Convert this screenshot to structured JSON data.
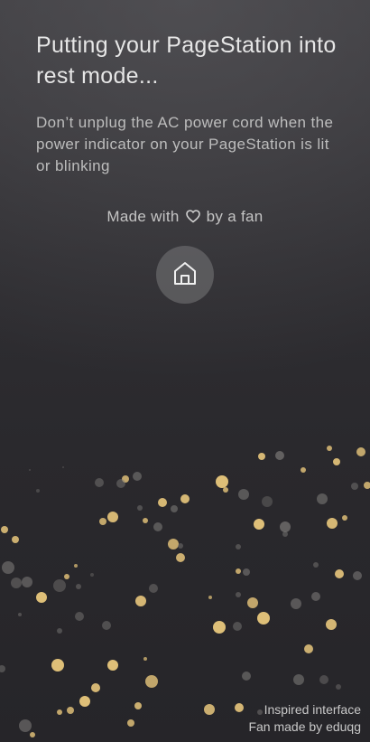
{
  "screen": {
    "title": "Putting your PageStation into rest mode...",
    "message": "Don’t unplug the AC power cord when the power indicator on your PageStation is lit or blinking",
    "made_with": {
      "prefix": "Made with",
      "heart_icon": "heart-outline-icon",
      "suffix": "by a fan"
    },
    "home_button": {
      "icon": "home-icon"
    }
  },
  "credits": {
    "line1": "Inspired interface",
    "line2": "Fan made by eduqg"
  },
  "colors": {
    "background_top": "#3b3a3e",
    "background_bottom": "#262529",
    "particle_gold": "#e8c77c",
    "particle_gray": "#7a7876",
    "text_primary": "#e6e6e6",
    "text_secondary": "#bdbdbd"
  }
}
